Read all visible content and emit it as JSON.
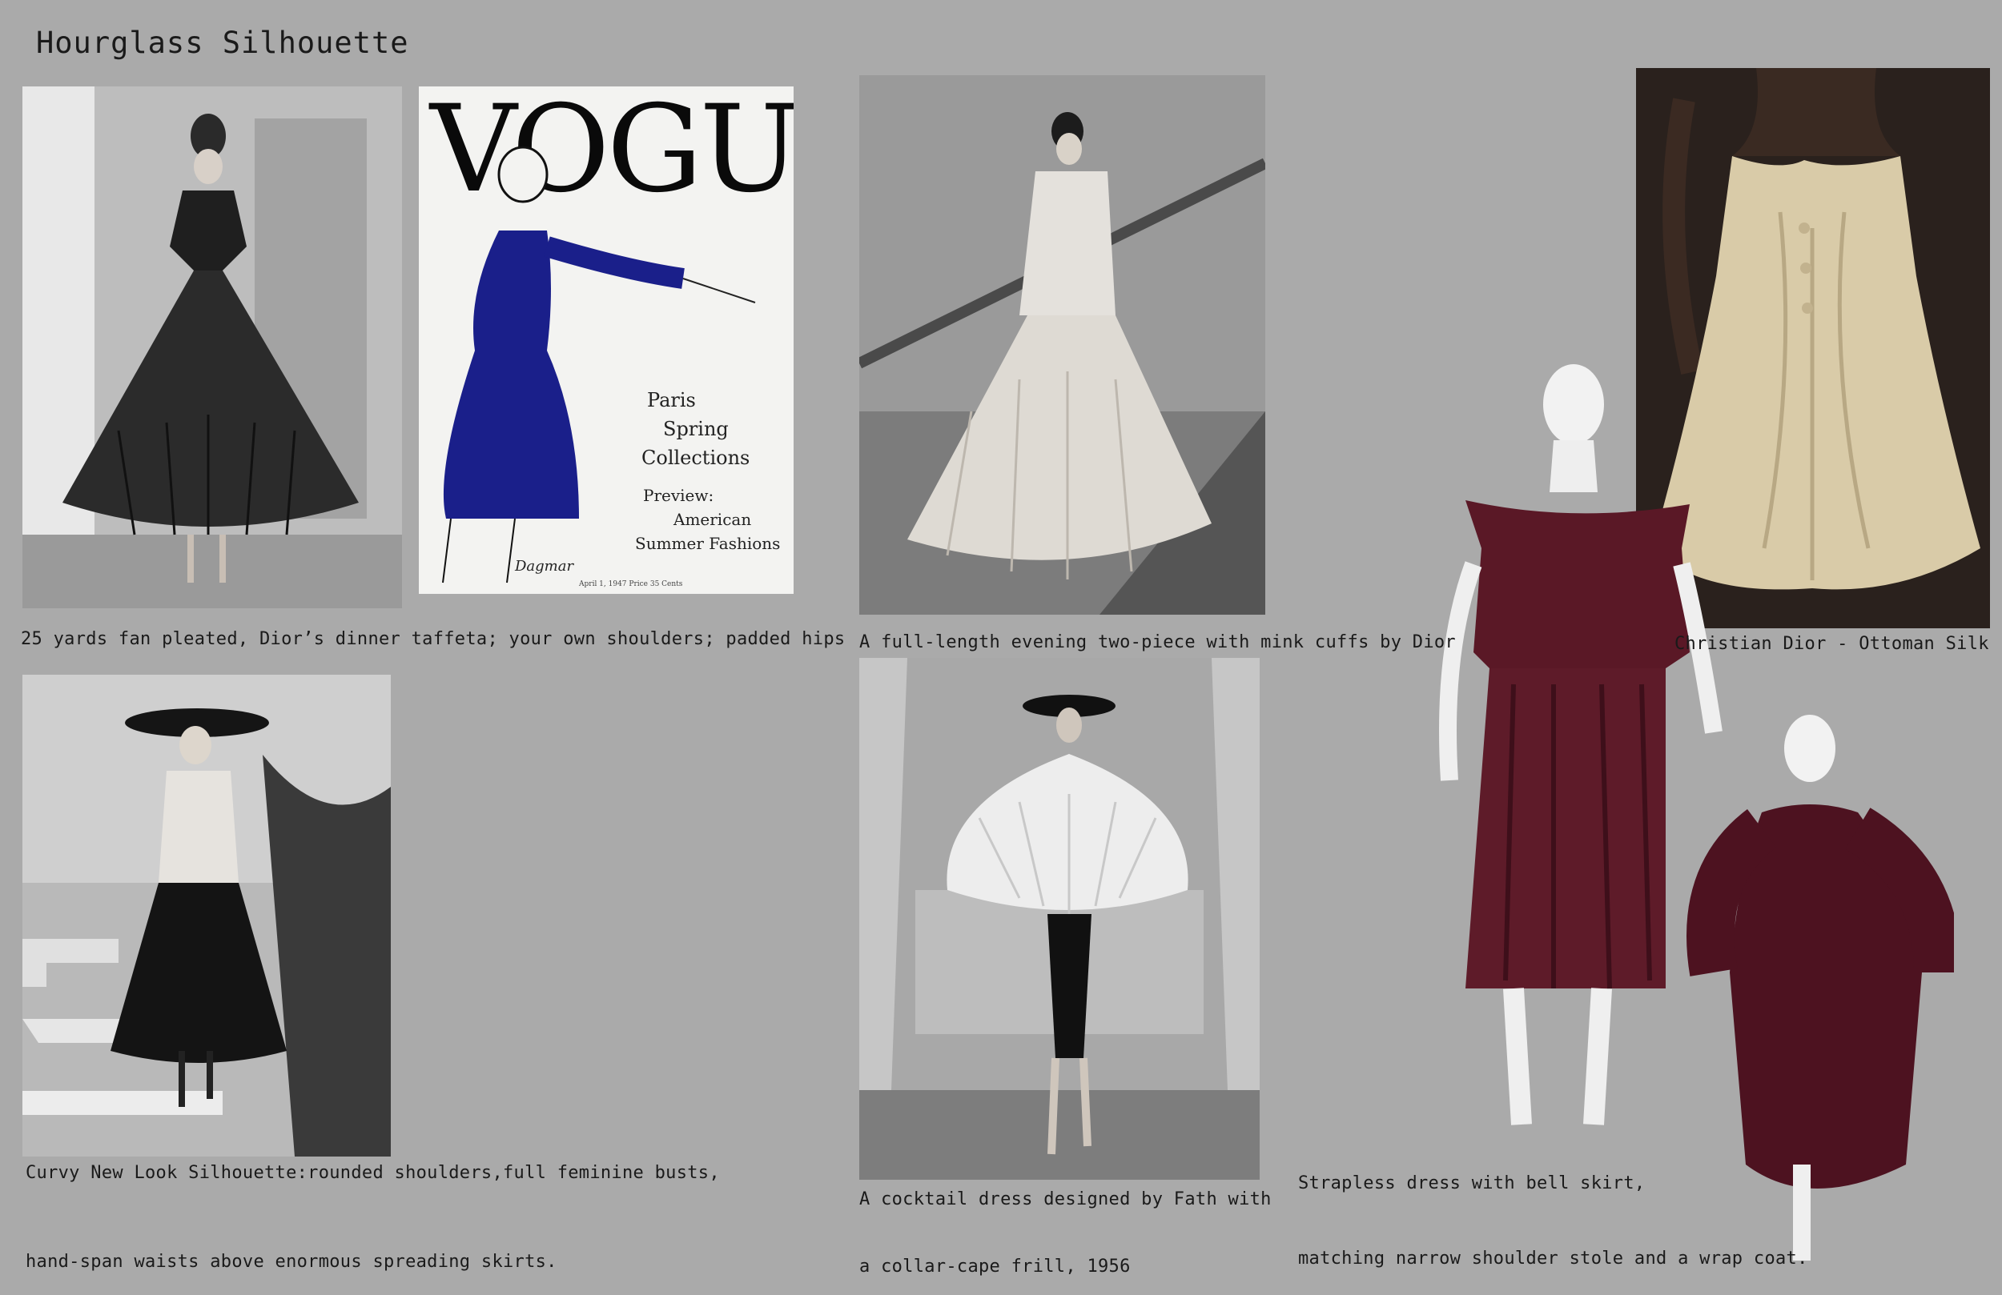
{
  "page": {
    "title": "Hourglass Silhouette"
  },
  "cover": {
    "masthead": "VOGUE",
    "headline1": "Paris",
    "headline2": "Spring",
    "headline3": "Collections",
    "preview1": "Preview:",
    "preview2": "American",
    "preview3": "Summer Fashions",
    "signature": "Dagmar",
    "issue_line": "April 1, 1947   Price 35 Cents"
  },
  "captions": {
    "photo1": "25 yards fan pleated, Dior’s dinner taffeta; your own shoulders; padded hips",
    "photo2": "A full-length evening two-piece with mink cuffs by Dior",
    "photo3": "Christian Dior - Ottoman Silk",
    "photo4": "Curvy New Look Silhouette:rounded shoulders,full feminine busts,",
    "photo4b": "hand-span waists above enormous spreading skirts.",
    "photo5": "A cocktail dress designed by Fath with",
    "photo5b": "a collar-cape frill, 1956",
    "photo6": "Strapless dress with bell skirt,",
    "photo6b": "matching narrow shoulder stole and a wrap coat."
  },
  "colors": {
    "background": "#aaaaaa",
    "vogue_blue": "#1a1f8a",
    "burgundy": "#5a1826",
    "ivory_silk": "#d9cba8"
  }
}
